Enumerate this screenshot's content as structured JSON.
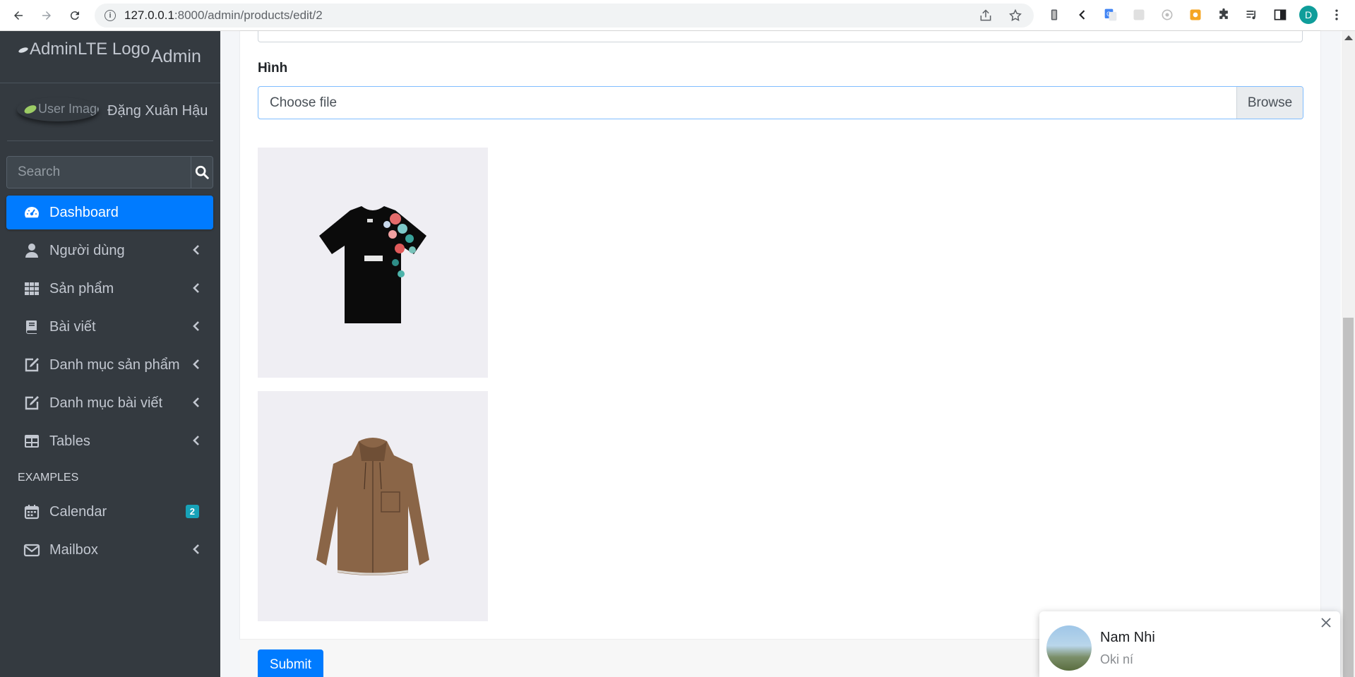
{
  "browser": {
    "url_host": "127.0.0.1",
    "url_path": ":8000/admin/products/edit/2",
    "profile_initial": "D"
  },
  "sidebar": {
    "brand_logo_alt": "AdminLTE Logo",
    "brand_text": "Admin",
    "user_image_alt": "User Image",
    "user_name": "Đặng Xuân Hậu",
    "search_placeholder": "Search",
    "items": [
      {
        "label": "Dashboard",
        "icon": "tachometer-icon",
        "active": true,
        "arrow": false
      },
      {
        "label": "Người dùng",
        "icon": "user-icon",
        "arrow": true
      },
      {
        "label": "Sản phẩm",
        "icon": "grid-icon",
        "arrow": true
      },
      {
        "label": "Bài viết",
        "icon": "book-icon",
        "arrow": true
      },
      {
        "label": "Danh mục sản phẩm",
        "icon": "edit-icon",
        "arrow": true
      },
      {
        "label": "Danh mục bài viết",
        "icon": "edit-icon",
        "arrow": true
      },
      {
        "label": "Tables",
        "icon": "table-icon",
        "arrow": true
      }
    ],
    "examples_header": "EXAMPLES",
    "examples": [
      {
        "label": "Calendar",
        "icon": "calendar-icon",
        "badge": "2"
      },
      {
        "label": "Mailbox",
        "icon": "envelope-icon",
        "arrow": true
      }
    ],
    "active_color": "#007bff",
    "bg_color": "#343a40"
  },
  "form": {
    "image_label": "Hình",
    "file_placeholder": "Choose file",
    "browse_label": "Browse",
    "images": [
      {
        "name": "black-floral-tshirt"
      },
      {
        "name": "brown-suede-hooded-shirt"
      }
    ],
    "submit_label": "Submit"
  },
  "chat": {
    "name": "Nam Nhi",
    "message": "Oki ní"
  }
}
